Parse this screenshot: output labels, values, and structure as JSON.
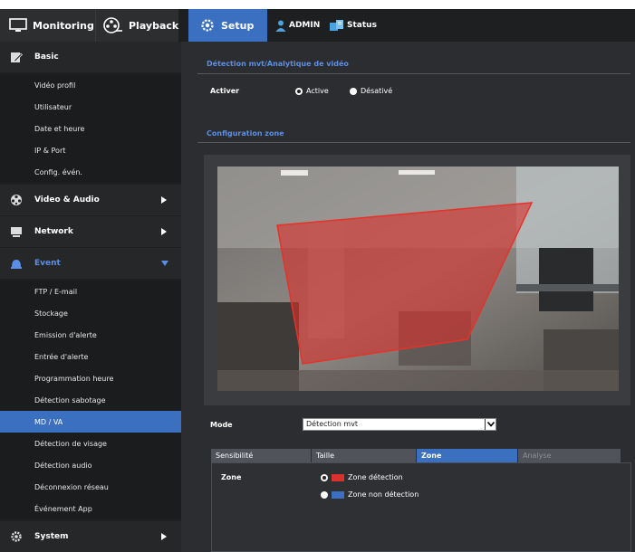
{
  "topnav": {
    "monitoring": "Monitoring",
    "playback": "Playback",
    "setup": "Setup",
    "admin": "ADMIN",
    "status": "Status"
  },
  "sidebar": {
    "basic": {
      "label": "Basic",
      "items": [
        "Vidéo profil",
        "Utilisateur",
        "Date et heure",
        "IP & Port",
        "Config. évén."
      ]
    },
    "video_audio": "Video & Audio",
    "network": "Network",
    "event": {
      "label": "Event",
      "items": [
        "FTP / E-mail",
        "Stockage",
        "Emission d'alerte",
        "Entrée d'alerte",
        "Programmation heure",
        "Détection sabotage",
        "MD / VA",
        "Détection de visage",
        "Détection audio",
        "Déconnexion réseau",
        "Événement App"
      ],
      "selected": "MD / VA"
    },
    "system": "System"
  },
  "main": {
    "section1_title": "Détection mvt/Analytique de vidéo",
    "activer_label": "Activer",
    "activer_options": [
      "Active",
      "Désativé"
    ],
    "activer_selected": "Active",
    "section2_title": "Configuration zone",
    "mode_label": "Mode",
    "mode_value": "Détection mvt",
    "tabs": [
      "Sensibilité",
      "Taille",
      "Zone",
      "Analyse"
    ],
    "active_tab": "Zone",
    "zone_label": "Zone",
    "zone_options": [
      "Zone détection",
      "Zone non détection"
    ],
    "zone_selected": "Zone détection"
  },
  "colors": {
    "accent": "#3b6fbf",
    "detection_zone": "#d9312c",
    "non_detection_zone": "#3b6fbf"
  }
}
